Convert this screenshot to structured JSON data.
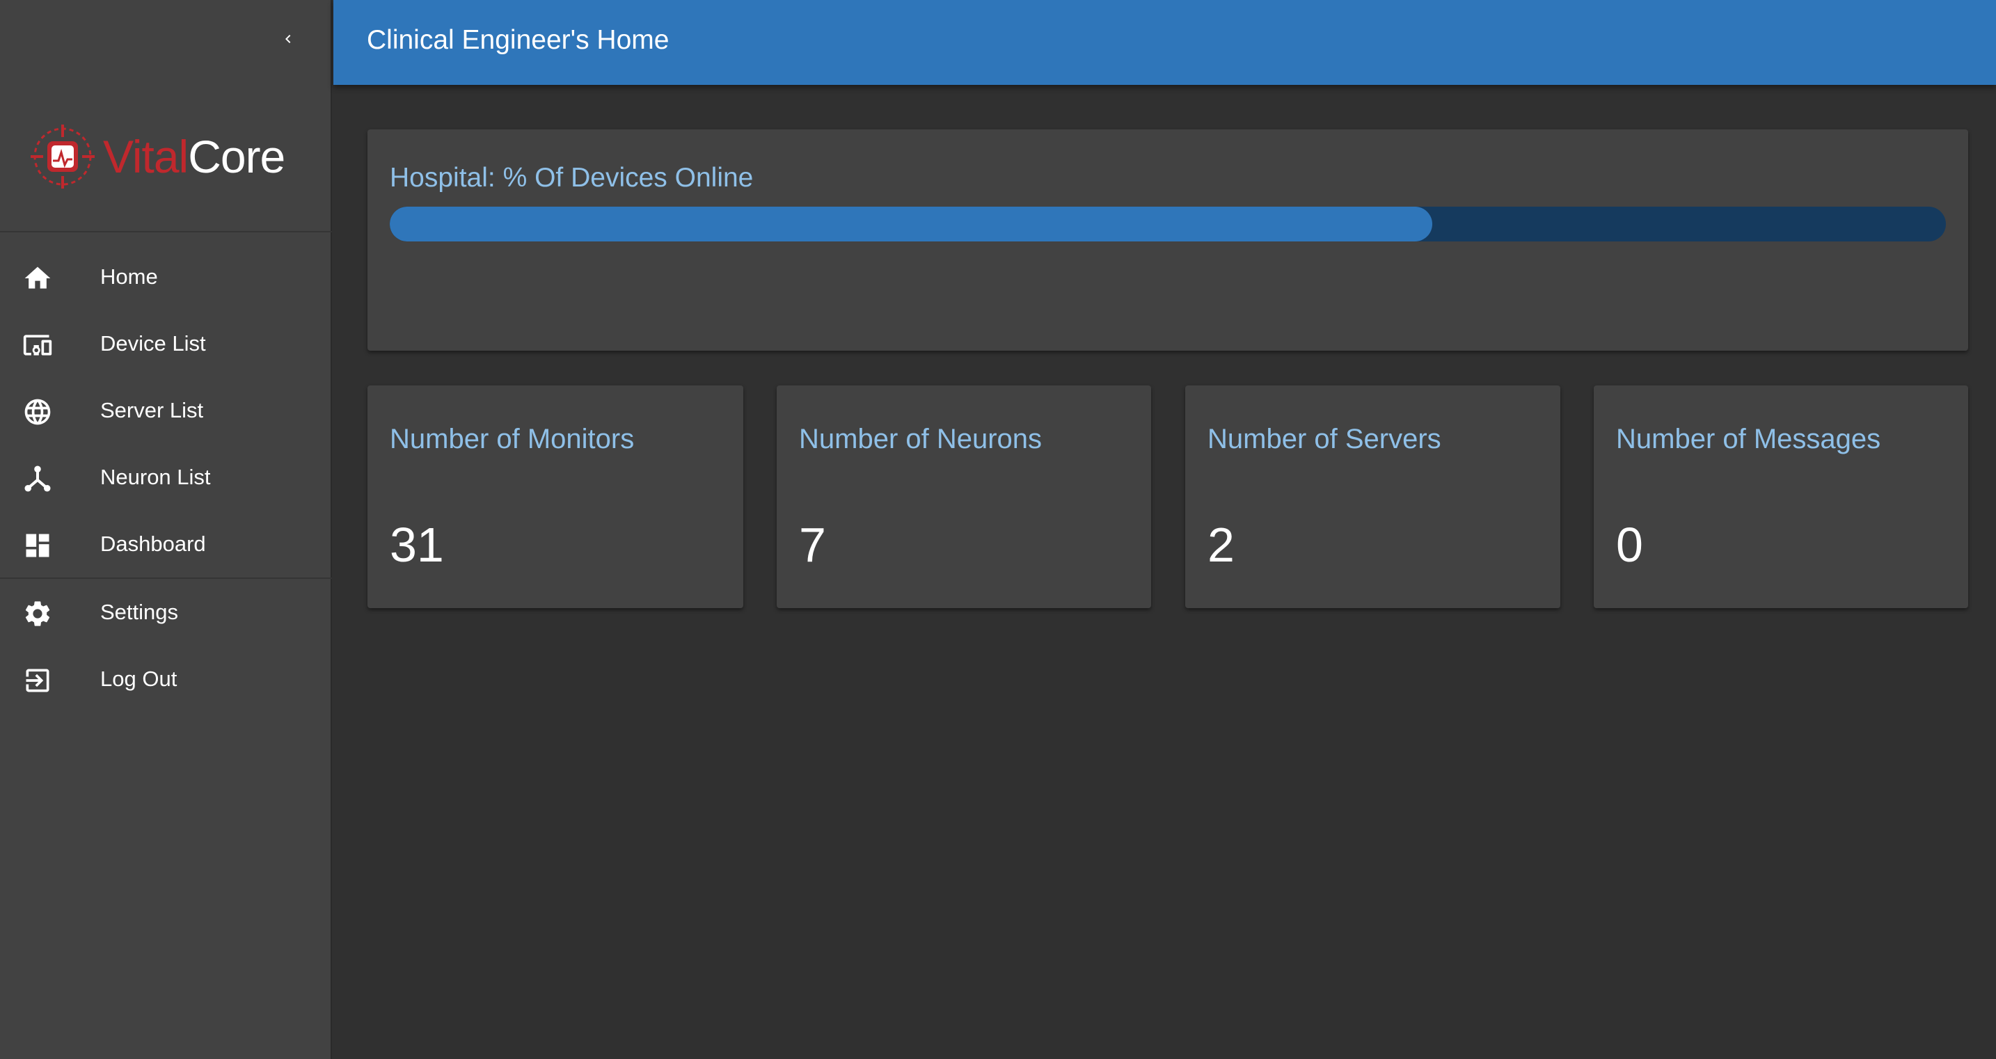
{
  "sidebar": {
    "logo": {
      "brand_part1": "Vital",
      "brand_part2": "Core"
    },
    "nav": [
      {
        "label": "Home",
        "icon": "home-icon"
      },
      {
        "label": "Device List",
        "icon": "devices-icon"
      },
      {
        "label": "Server List",
        "icon": "globe-icon"
      },
      {
        "label": "Neuron List",
        "icon": "hub-icon"
      },
      {
        "label": "Dashboard",
        "icon": "dashboard-icon"
      }
    ],
    "nav_secondary": [
      {
        "label": "Settings",
        "icon": "gear-icon"
      },
      {
        "label": "Log Out",
        "icon": "logout-icon"
      }
    ]
  },
  "header": {
    "title": "Clinical Engineer's Home"
  },
  "progress_card": {
    "title": "Hospital: % Of Devices Online",
    "percent_online": 67
  },
  "stats": [
    {
      "label": "Number of Monitors",
      "value": "31"
    },
    {
      "label": "Number of Neurons",
      "value": "7"
    },
    {
      "label": "Number of Servers",
      "value": "2"
    },
    {
      "label": "Number of Messages",
      "value": "0"
    }
  ],
  "colors": {
    "accent": "#2f76ba",
    "progress_track": "#153a5e",
    "card_label": "#8fc0e8",
    "brand_red": "#c0282d",
    "sidebar_bg": "#424242",
    "page_bg": "#303030"
  }
}
